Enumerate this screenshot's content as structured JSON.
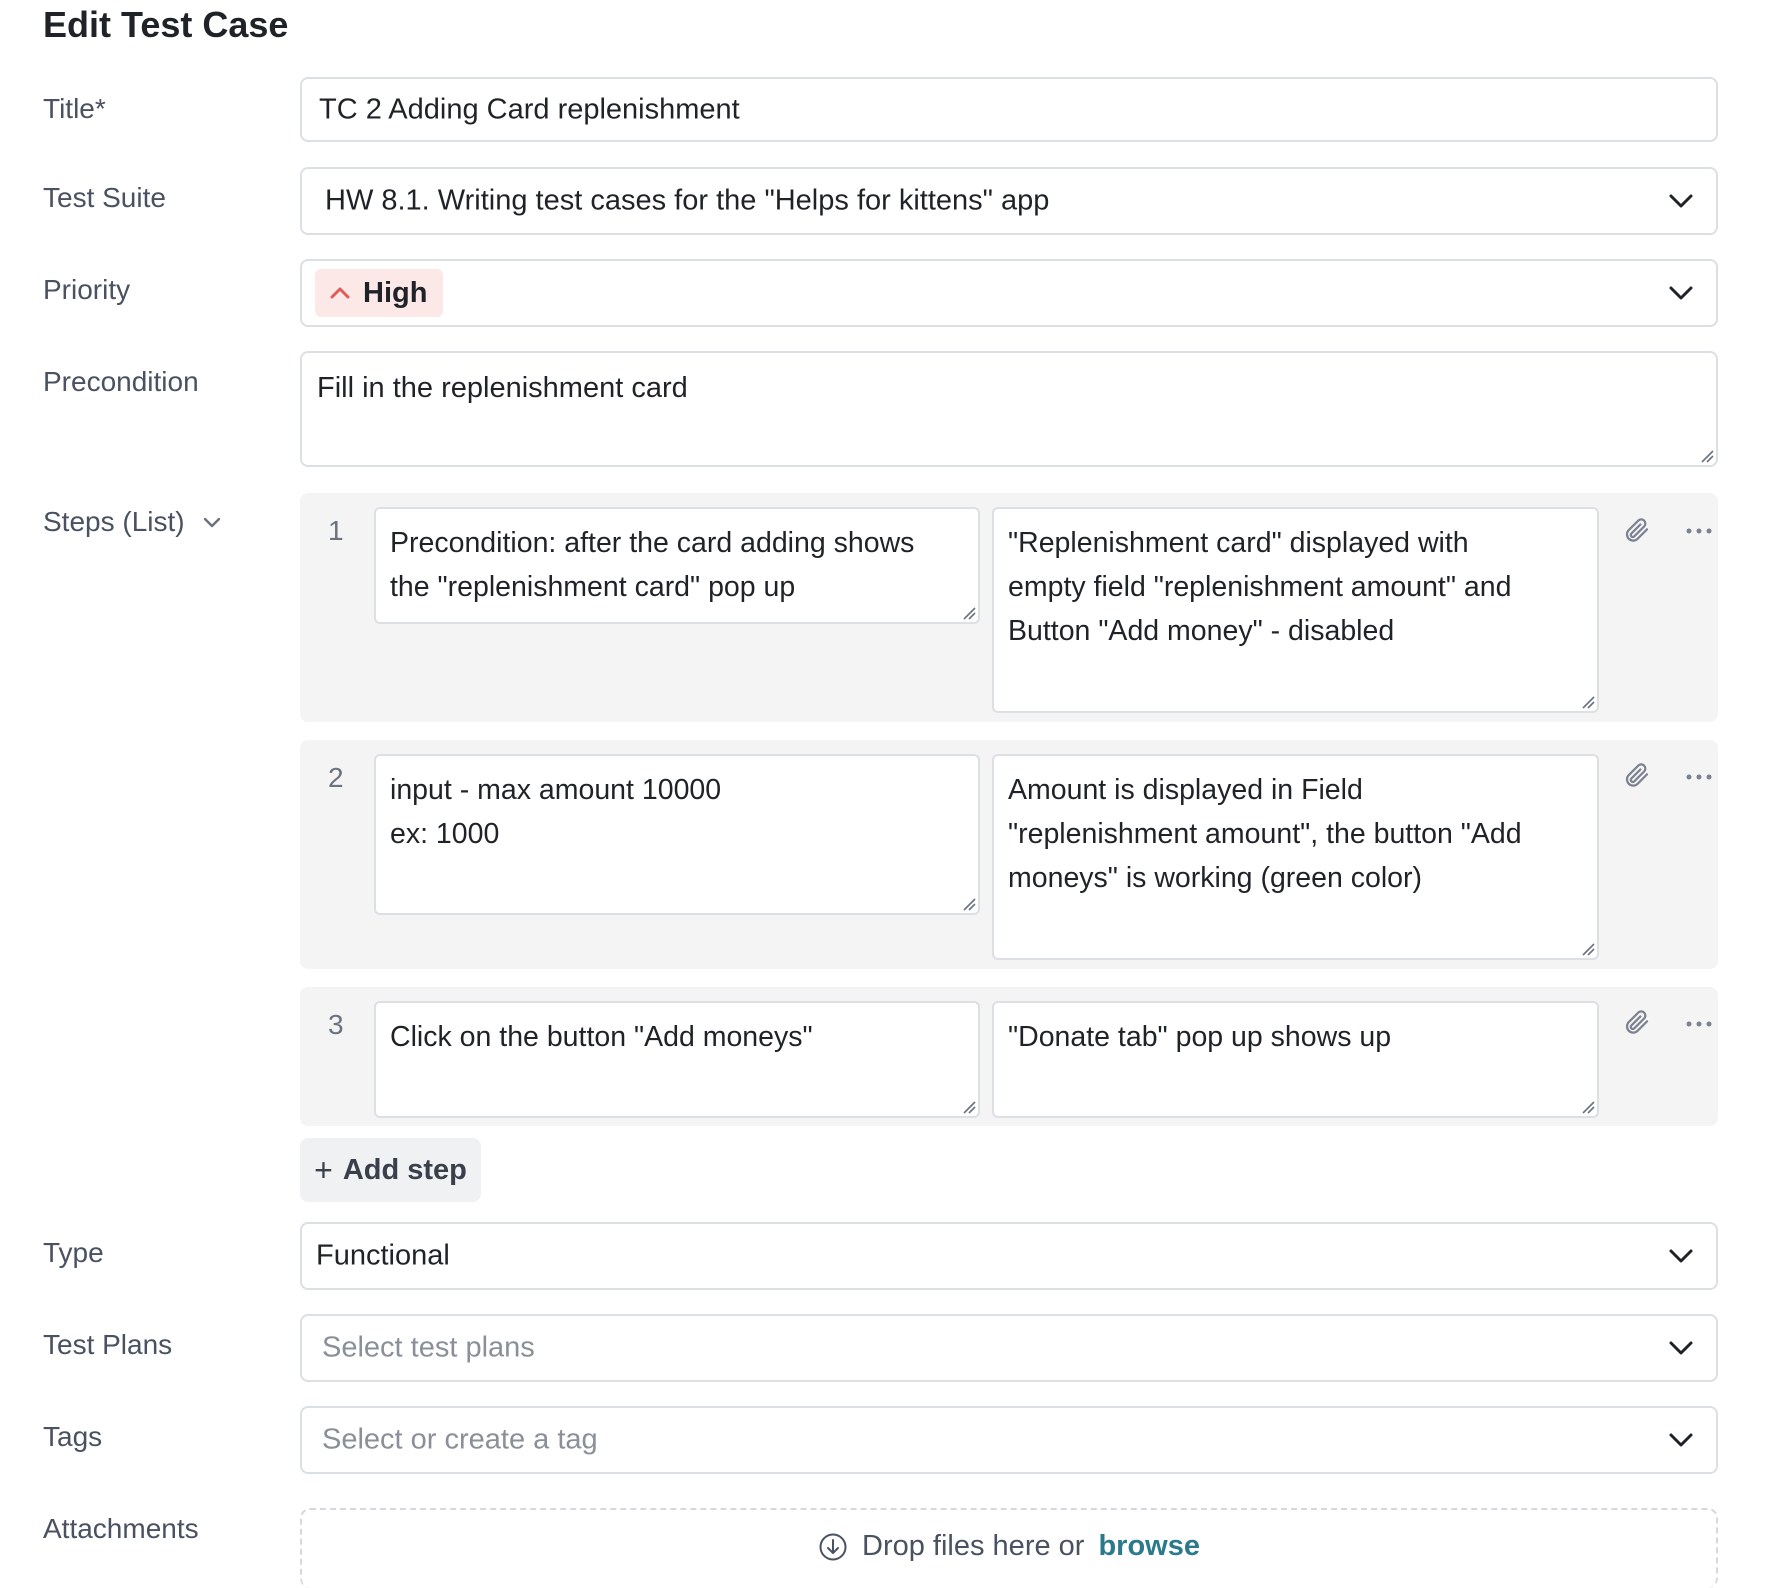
{
  "page": {
    "title": "Edit Test Case"
  },
  "labels": {
    "title": "Title*",
    "suite": "Test Suite",
    "priority": "Priority",
    "precondition": "Precondition",
    "steps": "Steps (List)",
    "type": "Type",
    "plans": "Test Plans",
    "tags": "Tags",
    "attachments": "Attachments"
  },
  "fields": {
    "title_value": "TC 2 Adding Card replenishment",
    "suite_value": "HW 8.1. Writing test cases for the \"Helps for kittens\" app",
    "priority_value": "High",
    "precondition_value": "Fill in the replenishment card",
    "type_value": "Functional",
    "plans_placeholder": "Select test plans",
    "tags_placeholder": "Select or create a tag"
  },
  "steps": [
    {
      "number": "1",
      "action": [
        "Precondition: after the card adding shows",
        "the \"replenishment card\" pop up"
      ],
      "expected": [
        "\"Replenishment card\" displayed with",
        "empty field \"replenishment amount\" and",
        "Button \"Add money\" - disabled"
      ]
    },
    {
      "number": "2",
      "action": [
        "input - max amount 10000",
        "ex: 1000"
      ],
      "expected": [
        "Amount is displayed in Field",
        "\"replenishment amount\", the button \"Add",
        "moneys\" is working (green color)"
      ]
    },
    {
      "number": "3",
      "action": [
        "Click on the button \"Add moneys\""
      ],
      "expected": [
        "\"Donate tab\" pop up shows up"
      ]
    }
  ],
  "add_step": {
    "plus": "+",
    "label": "Add step"
  },
  "attachments": {
    "text": "Drop files here or",
    "link": "browse"
  },
  "colors": {
    "priority_high": "#e05a5a",
    "priority_bg": "#fde8e8",
    "link": "#2b7a8c"
  },
  "icons": {
    "chevron": "chevron-down-icon",
    "attach": "paperclip-icon",
    "more": "more-horizontal-icon",
    "priority": "chevron-up-icon",
    "download": "download-circle-icon"
  }
}
